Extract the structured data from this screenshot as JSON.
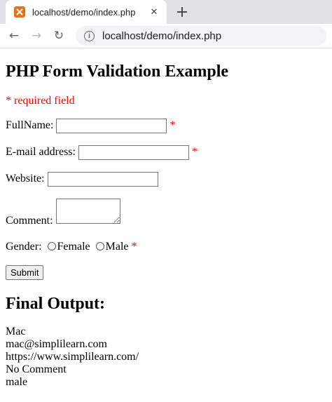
{
  "browser": {
    "tab_title": "localhost/demo/index.php",
    "url": "localhost/demo/index.php",
    "close_glyph": "✕",
    "newtab_glyph": "+",
    "back_glyph": "←",
    "forward_glyph": "→",
    "reload_glyph": "↻",
    "info_glyph": "i"
  },
  "form": {
    "title": "PHP Form Validation Example",
    "required_note": "* required field",
    "fullname_label": "FullName:",
    "email_label": "E-mail address:",
    "website_label": "Website:",
    "comment_label": "Comment:",
    "gender_label": "Gender:",
    "female_label": "Female",
    "male_label": "Male",
    "asterisk": "*",
    "submit_label": "Submit"
  },
  "output": {
    "title": "Final Output:",
    "name": "Mac",
    "email": "mac@simplilearn.com",
    "website": "https://www.simplilearn.com/",
    "comment": "No Comment",
    "gender": "male"
  },
  "colors": {
    "required": "#ff0000",
    "tabstrip": "#dee1e6",
    "favicon": "#e8721c"
  },
  "icons": [
    "xampp-favicon-icon",
    "close-icon",
    "plus-icon",
    "back-arrow-icon",
    "forward-arrow-icon",
    "reload-icon",
    "info-icon"
  ]
}
